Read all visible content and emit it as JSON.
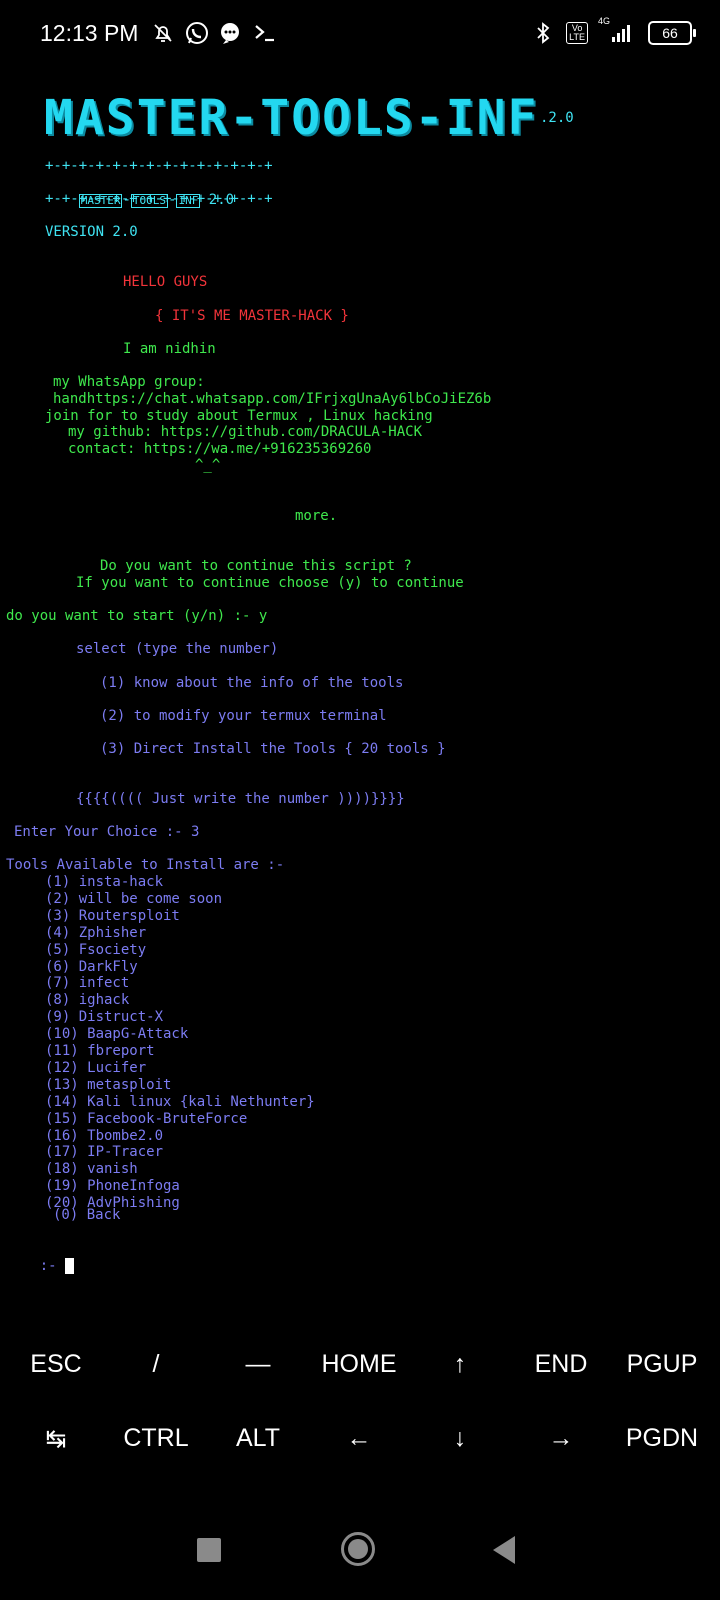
{
  "status_bar": {
    "time": "12:13 PM",
    "left_icons": [
      "notifications-off-icon",
      "whatsapp-icon",
      "chat-bubble-icon",
      "terminal-icon"
    ],
    "right_icons": [
      "bluetooth-icon",
      "volte-icon",
      "signal-4g-icon"
    ],
    "volte_label": "Vo\nLTE",
    "network_label": "4G",
    "battery": "66"
  },
  "terminal": {
    "banner": "MASTER-TOOLS-INF",
    "banner_version": ".2.0",
    "border_line": "+-+-+-+-+-+-+-+-+-+-+-+-+-+",
    "boxed_words": [
      "MASTER",
      "TOOLS",
      "INF"
    ],
    "boxed_suffix": " 2.0",
    "version": "VERSION 2.0",
    "hello": "HELLO GUYS",
    "its_me": "{ IT'S ME MASTER-HACK }",
    "i_am": "I am nidhin",
    "whatsapp_group": "my WhatsApp group:",
    "whatsapp_link": "handhttps://chat.whatsapp.com/IFrjxgUnaAy6lbCoJiEZ6b",
    "join": "join for to study about Termux , Linux hacking",
    "github": "my github: https://github.com/DRACULA-HACK",
    "contact": "contact: https://wa.me/+916235369260",
    "smile": "^_^",
    "more": "more.",
    "continue_q": "Do you want to continue this script ?",
    "continue_hint": "If you want to continue choose (y) to continue",
    "start_prompt": "do you want to start (y/n) :- y",
    "select": "select (type the number)",
    "options": [
      "(1) know about the info of the tools",
      "(2) to modify your termux terminal",
      "(3) Direct Install the Tools { 20 tools }"
    ],
    "just_write": "{{{{(((( Just write the number ))))}}}}",
    "enter_choice": "Enter Your Choice :- 3",
    "tools_header": "Tools Available to Install are :-",
    "tools": [
      "(1) insta-hack",
      "(2) will be come soon",
      "(3) Routersploit",
      "(4) Zphisher",
      "(5) Fsociety",
      "(6) DarkFly",
      "(7) infect",
      "(8) ighack",
      "(9) Distruct-X",
      "(10) BaapG-Attack",
      "(11) fbreport",
      "(12) Lucifer",
      "(13) metasploit",
      "(14) Kali linux {kali Nethunter}",
      "(15) Facebook-BruteForce",
      "(16) Tbombe2.0",
      "(17) IP-Tracer",
      "(18) vanish",
      "(19) PhoneInfoga",
      "(20) AdvPhishing"
    ],
    "back": "(0) Back",
    "prompt": ":-"
  },
  "extra_keys": {
    "row1": [
      "ESC",
      "/",
      "—",
      "HOME",
      "↑",
      "END",
      "PGUP"
    ],
    "row2": [
      "↹",
      "CTRL",
      "ALT",
      "←",
      "↓",
      "→",
      "PGDN"
    ]
  },
  "nav_bar": {
    "icons": [
      "recents-square-icon",
      "home-circle-icon",
      "back-triangle-icon"
    ]
  },
  "colors": {
    "cyan": "#3fe3f2",
    "green": "#3fe84d",
    "red": "#f2343a",
    "blue": "#7c7cf2"
  }
}
